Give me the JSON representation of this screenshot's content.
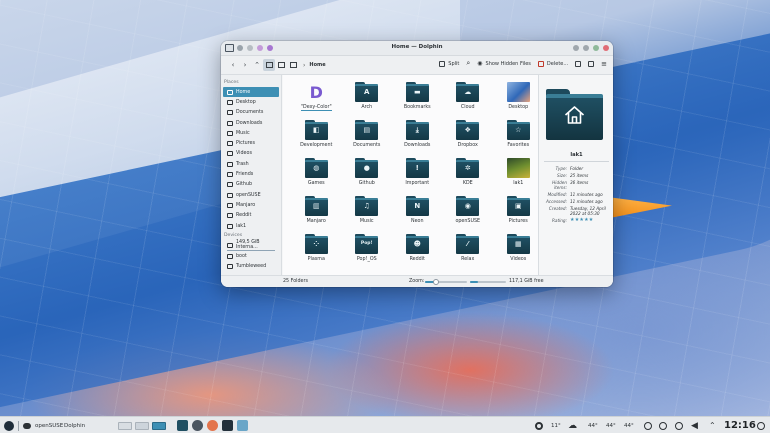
{
  "window": {
    "title": "Home — Dolphin",
    "title_dot_colors": [
      "#9aa3ab",
      "#b7bdc3",
      "#c49bd9",
      "#a776d1"
    ],
    "control_colors": [
      "#a0a7ad",
      "#a0a7ad",
      "#8fb99a",
      "#e06c75"
    ]
  },
  "toolbar": {
    "breadcrumb": "Home",
    "split_label": "Split",
    "hidden_label": "Show Hidden Files",
    "delete_label": "Delete..."
  },
  "sidebar": {
    "places_header": "Places",
    "places": [
      {
        "label": "Home",
        "icon": "home-icon",
        "active": true
      },
      {
        "label": "Desktop",
        "icon": "desktop-icon"
      },
      {
        "label": "Documents",
        "icon": "documents-icon"
      },
      {
        "label": "Downloads",
        "icon": "downloads-icon"
      },
      {
        "label": "Music",
        "icon": "music-icon"
      },
      {
        "label": "Pictures",
        "icon": "pictures-icon"
      },
      {
        "label": "Videos",
        "icon": "videos-icon"
      },
      {
        "label": "Trash",
        "icon": "trash-icon"
      },
      {
        "label": "Friends",
        "icon": "friends-icon"
      },
      {
        "label": "Github",
        "icon": "github-icon"
      },
      {
        "label": "openSUSE",
        "icon": "opensuse-icon"
      },
      {
        "label": "Manjaro",
        "icon": "manjaro-icon"
      },
      {
        "label": "Reddit",
        "icon": "reddit-icon"
      },
      {
        "label": "lak1",
        "icon": "star-icon"
      }
    ],
    "devices_header": "Devices",
    "devices": [
      {
        "label": "149,5 GiB Interna...",
        "icon": "drive-icon"
      },
      {
        "label": "boot",
        "icon": "drive-icon"
      },
      {
        "label": "Tumbleweed",
        "icon": "drive-icon"
      }
    ]
  },
  "files": [
    {
      "label": "\"Dexy-Color\"",
      "glyph": "D",
      "kind": "logo"
    },
    {
      "label": "Arch",
      "glyph": "A",
      "kind": "folder"
    },
    {
      "label": "Bookmarks",
      "glyph": "▬",
      "kind": "folder"
    },
    {
      "label": "Cloud",
      "glyph": "☁",
      "kind": "folder"
    },
    {
      "label": "Desktop",
      "glyph": "",
      "kind": "wallpaper"
    },
    {
      "label": "Development",
      "glyph": "◧",
      "kind": "folder"
    },
    {
      "label": "Documents",
      "glyph": "▤",
      "kind": "folder"
    },
    {
      "label": "Downloads",
      "glyph": "⤓",
      "kind": "folder"
    },
    {
      "label": "Dropbox",
      "glyph": "❖",
      "kind": "folder"
    },
    {
      "label": "Favorites",
      "glyph": "☆",
      "kind": "folder"
    },
    {
      "label": "Games",
      "glyph": "◍",
      "kind": "folder"
    },
    {
      "label": "Github",
      "glyph": "●",
      "kind": "folder"
    },
    {
      "label": "Important",
      "glyph": "!",
      "kind": "folder"
    },
    {
      "label": "KDE",
      "glyph": "✲",
      "kind": "folder"
    },
    {
      "label": "lak1",
      "glyph": "",
      "kind": "photo"
    },
    {
      "label": "Manjaro",
      "glyph": "▥",
      "kind": "folder"
    },
    {
      "label": "Music",
      "glyph": "♫",
      "kind": "folder"
    },
    {
      "label": "Neon",
      "glyph": "N",
      "kind": "folder"
    },
    {
      "label": "openSUSE",
      "glyph": "◉",
      "kind": "folder"
    },
    {
      "label": "Pictures",
      "glyph": "▣",
      "kind": "folder"
    },
    {
      "label": "Plasma",
      "glyph": "⁘",
      "kind": "folder"
    },
    {
      "label": "Pop!_OS",
      "glyph": "Pop!",
      "kind": "folder"
    },
    {
      "label": "Reddit",
      "glyph": "☻",
      "kind": "folder"
    },
    {
      "label": "Relax",
      "glyph": "⁄",
      "kind": "folder"
    },
    {
      "label": "Videos",
      "glyph": "▦",
      "kind": "folder"
    }
  ],
  "info": {
    "name": "lak1",
    "rows": [
      {
        "key": "Type:",
        "value": "Folder"
      },
      {
        "key": "Size:",
        "value": "25 items"
      },
      {
        "key": "Hidden items:",
        "value": "36 items"
      },
      {
        "key": "Modified:",
        "value": "11 minutes ago"
      },
      {
        "key": "Accessed:",
        "value": "11 minutes ago"
      },
      {
        "key": "Created:",
        "value": "Tuesday, 12 April 2022 at 05:30"
      }
    ],
    "rating_label": "Rating:",
    "rating_stars": 5
  },
  "status": {
    "count": "25 Folders",
    "zoom_label": "Zoom:",
    "zoom_level": 0.25,
    "space_used_fraction": 0.22,
    "free_space": "117,1 GiB free"
  },
  "taskbar": {
    "distro": "openSUSE",
    "app": "Dolphin",
    "temp": "11°",
    "cpu1": "44°",
    "cpu2": "44°",
    "cpu3": "44°",
    "time": "12:16"
  }
}
